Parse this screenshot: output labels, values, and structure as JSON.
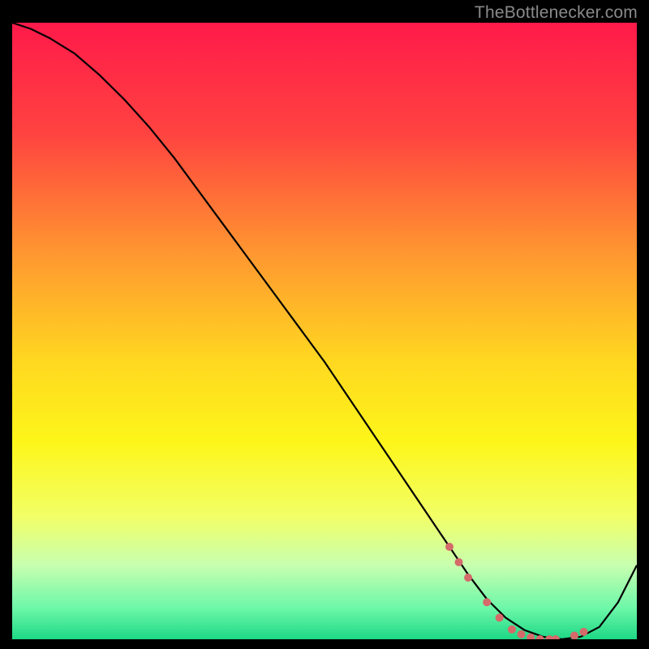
{
  "watermark": "TheBottlenecker.com",
  "chart_data": {
    "type": "line",
    "title": "",
    "xlabel": "",
    "ylabel": "",
    "xlim": [
      0,
      100
    ],
    "ylim": [
      0,
      100
    ],
    "grid": false,
    "background_gradient": {
      "stops": [
        {
          "offset": 0,
          "color": "#ff1a4a"
        },
        {
          "offset": 18,
          "color": "#ff4340"
        },
        {
          "offset": 38,
          "color": "#ff9930"
        },
        {
          "offset": 55,
          "color": "#ffd820"
        },
        {
          "offset": 68,
          "color": "#fdf61a"
        },
        {
          "offset": 80,
          "color": "#f2ff66"
        },
        {
          "offset": 88,
          "color": "#c8ffb0"
        },
        {
          "offset": 95,
          "color": "#6cf7a8"
        },
        {
          "offset": 100,
          "color": "#1dd885"
        }
      ]
    },
    "series": [
      {
        "name": "curve",
        "color": "#000000",
        "x": [
          0,
          3,
          6,
          10,
          14,
          18,
          22,
          26,
          30,
          34,
          38,
          42,
          46,
          50,
          54,
          58,
          62,
          66,
          70,
          73,
          76,
          79,
          82,
          85,
          88,
          91,
          94,
          97,
          100
        ],
        "y": [
          100,
          99,
          97.5,
          95,
          91.5,
          87.5,
          83,
          78,
          72.5,
          67,
          61.5,
          56,
          50.5,
          45,
          39,
          33,
          27,
          21,
          15,
          10.5,
          6.5,
          3.5,
          1.5,
          0.4,
          0,
          0.4,
          2,
          6,
          12
        ]
      }
    ],
    "markers": {
      "name": "data-points",
      "color": "#d46a6a",
      "radius": 5,
      "x": [
        70,
        71.5,
        73,
        76,
        78,
        80,
        81.5,
        83,
        84.5,
        86,
        87,
        90,
        91.5
      ],
      "y": [
        15,
        12.5,
        10,
        6,
        3.5,
        1.6,
        0.8,
        0.3,
        0,
        0,
        0,
        0.6,
        1.2
      ]
    }
  }
}
